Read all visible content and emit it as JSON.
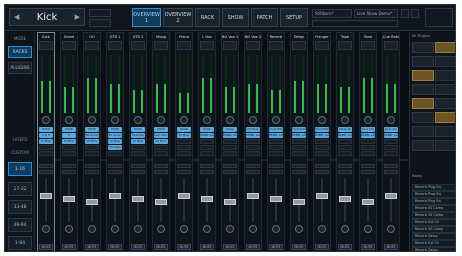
{
  "header": {
    "channel_name": "Kick",
    "overview1_label": "OVERVIEW 1",
    "overview2_label": "OVERVIEW 2",
    "rack_label": "RACK",
    "show_label": "SHOW",
    "patch_label": "PATCH",
    "setup_label": "SETUP",
    "snapshot_value": "Stillborn*",
    "live_show_value": "Live Show Demo*"
  },
  "left_nav": {
    "mode_label": "MODE",
    "racks_label": "RACKS",
    "plugins_label": "PLUGINS",
    "layers_label": "LAYERS",
    "custom_label": "CUSTOM",
    "layer_buttons": [
      "1-16",
      "17-32",
      "33-48",
      "49-64",
      "1-64"
    ]
  },
  "channels": [
    {
      "name": "Kick",
      "slots": [
        "PUCE",
        "C & H",
        "AT Melv"
      ],
      "mute": "MUTE"
    },
    {
      "name": "Snare",
      "slots": [
        "PUCE",
        "C",
        "AT Melv"
      ],
      "mute": "MUTE"
    },
    {
      "name": "OH",
      "slots": [
        "PUCE",
        "Kit Comp",
        "AT Melv"
      ],
      "mute": "MUTE"
    },
    {
      "name": "GTR 1",
      "slots": [
        "PUCE",
        "Kit Comp",
        "AT Melv",
        "HD Melv"
      ],
      "mute": "MUTE"
    },
    {
      "name": "GTR 2",
      "slots": [
        "PUCE",
        "SpecVas",
        "AT Melv"
      ],
      "mute": "MUTE"
    },
    {
      "name": "Moog",
      "slots": [
        "PUCE",
        "Spec Vox Ch",
        "AT Melv"
      ],
      "mute": "MUTE"
    },
    {
      "name": "Piano",
      "slots": [
        "PUCE",
        "AT Melv"
      ],
      "mute": "MUTE"
    },
    {
      "name": "L Vox",
      "slots": [
        "Plate",
        "REBEL Leslie"
      ],
      "mute": "MUTE"
    },
    {
      "name": "BG Vox 1",
      "slots": [
        "Plate",
        "REBEL Leslie"
      ],
      "mute": "MUTE"
    },
    {
      "name": "BG Vox 2",
      "slots": [
        "H-Delay",
        "REBEL Leslie"
      ],
      "mute": "MUTE"
    },
    {
      "name": "Reverb",
      "slots": [
        "Vocal Plate",
        "REBEL Leslie"
      ],
      "mute": "MUTE"
    },
    {
      "name": "Delay",
      "slots": [
        "Vocal Plate",
        "REBEL Leslie"
      ],
      "mute": "MUTE"
    },
    {
      "name": "Flanger",
      "slots": [
        "Vocal Plate",
        "REBEL Leslie"
      ],
      "mute": "MUTE"
    },
    {
      "name": "Tape",
      "slots": [
        "Delay Ch",
        "REBEL Leslie"
      ],
      "mute": "MUTE"
    },
    {
      "name": "Tone",
      "slots": [
        "Spec Vox",
        "REBEL Leslie"
      ],
      "mute": "MUTE"
    },
    {
      "name": "Cue Bots",
      "slots": [
        "Spec Vox",
        "REBEL Leslie"
      ],
      "mute": "MUTE"
    }
  ],
  "meter_levels": [
    0.55,
    0.45,
    0.6,
    0.5,
    0.4,
    0.5,
    0.35,
    0.6,
    0.45,
    0.5,
    0.4,
    0.55,
    0.5,
    0.45,
    0.6,
    0.5
  ],
  "right_panel": {
    "top_label": "All Plugins",
    "bottom_label": "Racks",
    "items": [
      "Reverb",
      "Reverb",
      "Reverb",
      "Reverb",
      "Reverb",
      "Reverb",
      "Reverb",
      "Reverb",
      "Reverb",
      "Reverb"
    ],
    "item_right": [
      "Plug Eq",
      "Plug Eq",
      "Plug Eq",
      "SS Comp",
      "SS Comp",
      "Ext Ch",
      "SS Comp",
      "Delay",
      "Ext Ch",
      "Delay"
    ]
  },
  "colors": {
    "accent": "#2b8fd6",
    "slot": "#5aa8e0",
    "meter": "#2fbf4f"
  }
}
